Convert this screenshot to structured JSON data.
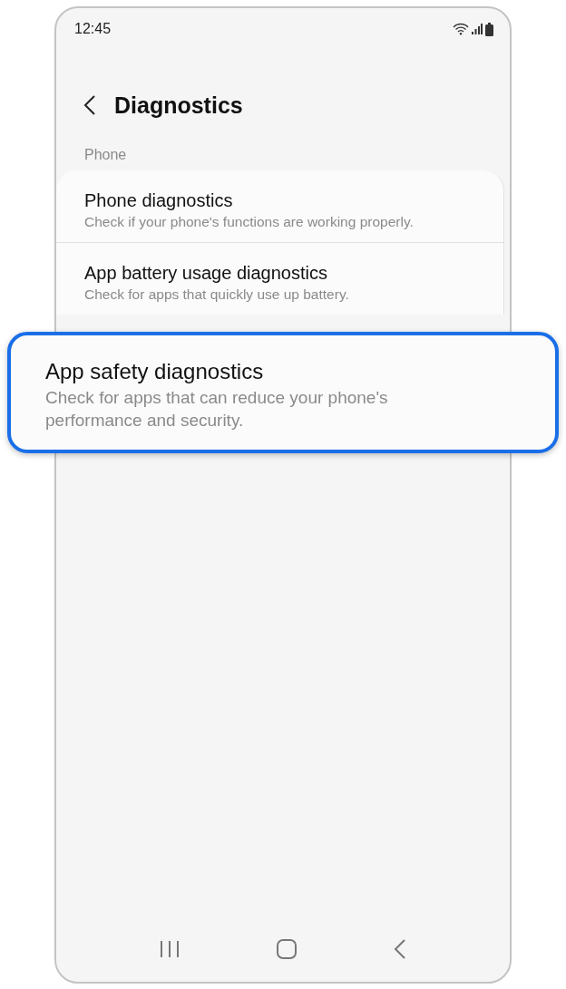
{
  "status_bar": {
    "time": "12:45"
  },
  "header": {
    "title": "Diagnostics"
  },
  "section": {
    "label": "Phone"
  },
  "items": [
    {
      "title": "Phone diagnostics",
      "subtitle": "Check if your phone's functions are working properly.",
      "highlighted": false
    },
    {
      "title": "App battery usage diagnostics",
      "subtitle": "Check for apps that quickly use up battery.",
      "highlighted": false
    },
    {
      "title": "App safety diagnostics",
      "subtitle": "Check for apps that can reduce your phone's performance and security.",
      "highlighted": true
    }
  ]
}
